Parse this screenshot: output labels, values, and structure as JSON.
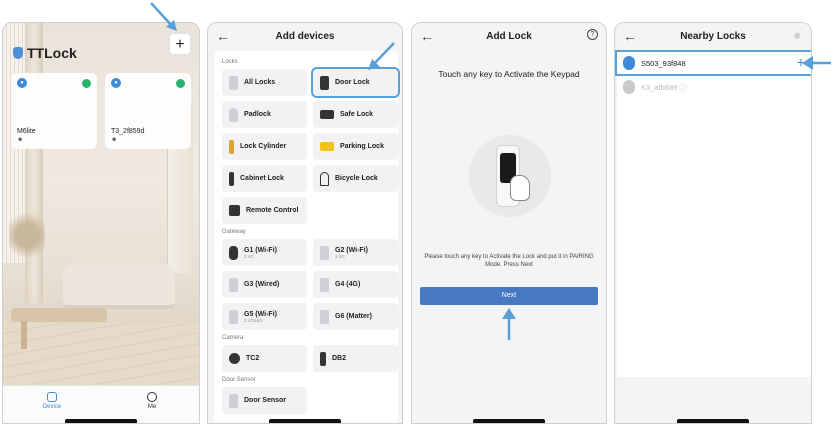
{
  "screen1": {
    "brand": "TTLock",
    "add_label": "+",
    "locks": [
      {
        "name": "M6lite"
      },
      {
        "name": "T3_2f859d"
      }
    ],
    "tabs": [
      {
        "label": "Device"
      },
      {
        "label": "Me"
      }
    ]
  },
  "screen2": {
    "title": "Add devices",
    "sections": {
      "locks": "Locks",
      "gateway": "Gateway",
      "camera": "Camera",
      "sensor": "Door Sensor"
    },
    "items": {
      "all_locks": "All Locks",
      "door_lock": "Door Lock",
      "padlock": "Padlock",
      "safe_lock": "Safe Lock",
      "lock_cylinder": "Lock Cylinder",
      "parking_lock": "Parking Lock",
      "cabinet_lock": "Cabinet Lock",
      "bicycle_lock": "Bicycle Lock",
      "remote_control": "Remote Control",
      "g1": "G1 (Wi-Fi)",
      "g1_sub": "2.4G",
      "g2": "G2 (Wi-Fi)",
      "g2_sub": "2.4G",
      "g3": "G3 (Wired)",
      "g4": "G4 (4G)",
      "g5": "G5 (Wi-Fi)",
      "g5_sub": "2.4G&5G",
      "g6": "G6 (Matter)",
      "tc2": "TC2",
      "db2": "DB2",
      "door_sensor": "Door Sensor"
    }
  },
  "screen3": {
    "title": "Add Lock",
    "help": "?",
    "heading": "Touch any key to Activate the Keypad",
    "description": "Please touch any key to Activate the Lock and put it in PAIRING Mode. Press Next",
    "next_label": "Next"
  },
  "screen4": {
    "title": "Nearby Locks",
    "locks": [
      {
        "name": "S503_93f848",
        "action": "+"
      },
      {
        "name": "K3_afb689 ⓘ"
      }
    ]
  },
  "colors": {
    "accent": "#4778c2",
    "highlight": "#5aa0d8",
    "lock_blue": "#3e8ad8",
    "battery_green": "#29b36a"
  }
}
